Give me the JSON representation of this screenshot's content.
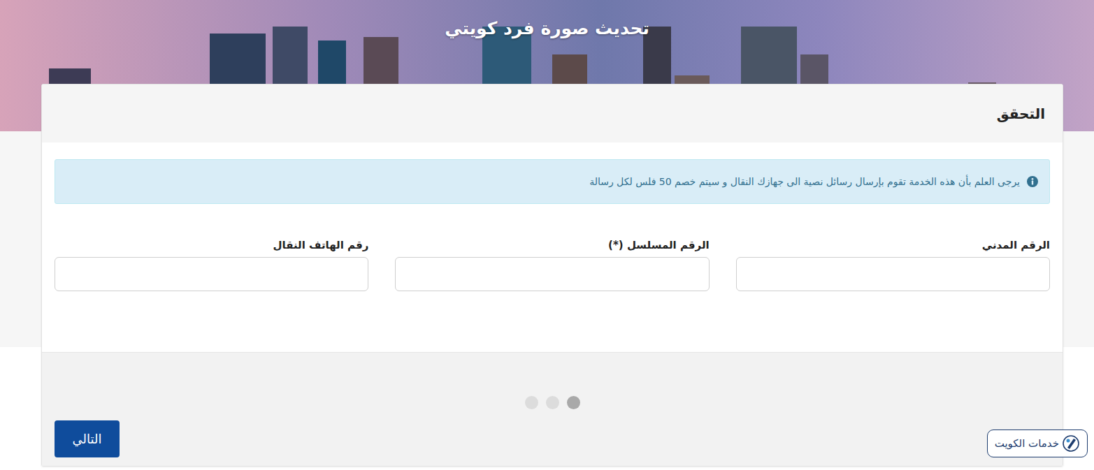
{
  "banner": {
    "title": "تحديث صورة فرد كويتي"
  },
  "card": {
    "title": "التحقق"
  },
  "alert": {
    "text": "يرجى العلم بأن هذه الخدمة تقوم بإرسال رسائل نصية الى جهازك النقال و سيتم خصم 50 فلس لكل رسالة"
  },
  "fields": [
    {
      "label": "الرقم المدني",
      "value": ""
    },
    {
      "label": "الرقم المسلسل (*)",
      "value": ""
    },
    {
      "label": "رقم الهاتف النقال",
      "value": ""
    }
  ],
  "steps": [
    {
      "selected": true
    },
    {
      "selected": false
    },
    {
      "selected": false
    }
  ],
  "buttons": [
    "التالي"
  ],
  "watermark": {
    "text": "خدمات الكويت"
  }
}
